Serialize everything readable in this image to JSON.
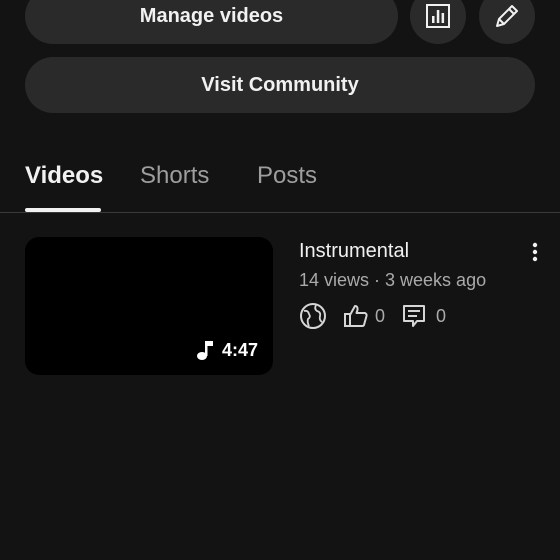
{
  "header": {
    "manage_label": "Manage videos",
    "visit_label": "Visit Community"
  },
  "tabs": [
    {
      "label": "Videos",
      "active": true
    },
    {
      "label": "Shorts",
      "active": false
    },
    {
      "label": "Posts",
      "active": false
    }
  ],
  "video": {
    "title": "Instrumental",
    "meta": "14 views · 3 weeks ago",
    "duration": "4:47",
    "likes": "0",
    "comments": "0",
    "thumb_icon": "music-note-icon",
    "visibility_icon": "globe-icon"
  },
  "colors": {
    "background": "#131313",
    "button_bg": "#2a2a2a",
    "text_primary": "#f1f1f1",
    "text_secondary": "#aaaaaa"
  }
}
